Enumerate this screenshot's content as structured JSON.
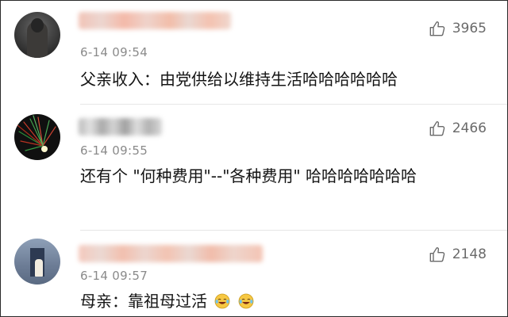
{
  "comments": [
    {
      "timestamp": "6-14 09:54",
      "text": "父亲收入：由党供给以维持生活哈哈哈哈哈哈",
      "likes": "3965",
      "like_icon": "thumbs-up-icon"
    },
    {
      "timestamp": "6-14 09:55",
      "text": "还有个 \"何种费用\"--\"各种费用\" 哈哈哈哈哈哈哈",
      "likes": "2466",
      "like_icon": "thumbs-up-icon"
    },
    {
      "timestamp": "6-14 09:57",
      "text": "母亲：靠祖母过活",
      "emojis": [
        "laughing-crying-emoji",
        "laughing-crying-emoji"
      ],
      "likes": "2148",
      "like_icon": "thumbs-up-icon"
    }
  ],
  "colors": {
    "timestamp": "#8a8a8a",
    "text": "#141414",
    "like": "#6a6a6a",
    "emoji_face": "#f7c843"
  }
}
